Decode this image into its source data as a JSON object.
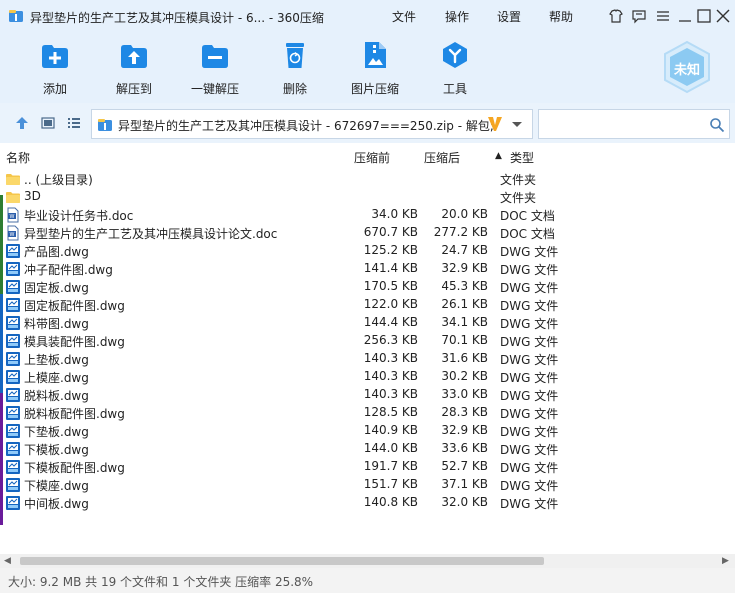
{
  "window": {
    "title": "异型垫片的生产工艺及其冲压模具设计 - 6... - 360压缩",
    "menus": [
      "文件",
      "操作",
      "设置",
      "帮助"
    ]
  },
  "toolbar": {
    "add": "添加",
    "extract_to": "解压到",
    "one_click_extract": "一键解压",
    "delete": "删除",
    "image_compress": "图片压缩",
    "tools": "工具"
  },
  "badge": {
    "label": "未知"
  },
  "address": {
    "path": "异型垫片的生产工艺及其冲压模具设计 - 672697===250.zip - 解包;"
  },
  "search": {
    "placeholder": "",
    "value": ""
  },
  "columns": {
    "name": "名称",
    "size": "压缩前",
    "packed": "压缩后",
    "type": "类型",
    "sort_glyph": "▲"
  },
  "files": [
    {
      "name": ".. (上级目录)",
      "size": "",
      "packed": "",
      "type": "文件夹",
      "icon": "folder"
    },
    {
      "name": "3D",
      "size": "",
      "packed": "",
      "type": "文件夹",
      "icon": "folder"
    },
    {
      "name": "毕业设计任务书.doc",
      "size": "34.0 KB",
      "packed": "20.0 KB",
      "type": "DOC 文档",
      "icon": "doc"
    },
    {
      "name": "异型垫片的生产工艺及其冲压模具设计论文.doc",
      "size": "670.7 KB",
      "packed": "277.2 KB",
      "type": "DOC 文档",
      "icon": "doc"
    },
    {
      "name": "产品图.dwg",
      "size": "125.2 KB",
      "packed": "24.7 KB",
      "type": "DWG 文件",
      "icon": "dwg"
    },
    {
      "name": "冲子配件图.dwg",
      "size": "141.4 KB",
      "packed": "32.9 KB",
      "type": "DWG 文件",
      "icon": "dwg"
    },
    {
      "name": "固定板.dwg",
      "size": "170.5 KB",
      "packed": "45.3 KB",
      "type": "DWG 文件",
      "icon": "dwg"
    },
    {
      "name": "固定板配件图.dwg",
      "size": "122.0 KB",
      "packed": "26.1 KB",
      "type": "DWG 文件",
      "icon": "dwg"
    },
    {
      "name": "料带图.dwg",
      "size": "144.4 KB",
      "packed": "34.1 KB",
      "type": "DWG 文件",
      "icon": "dwg"
    },
    {
      "name": "模具装配件图.dwg",
      "size": "256.3 KB",
      "packed": "70.1 KB",
      "type": "DWG 文件",
      "icon": "dwg"
    },
    {
      "name": "上垫板.dwg",
      "size": "140.3 KB",
      "packed": "31.6 KB",
      "type": "DWG 文件",
      "icon": "dwg"
    },
    {
      "name": "上模座.dwg",
      "size": "140.3 KB",
      "packed": "30.2 KB",
      "type": "DWG 文件",
      "icon": "dwg"
    },
    {
      "name": "脱料板.dwg",
      "size": "140.3 KB",
      "packed": "33.0 KB",
      "type": "DWG 文件",
      "icon": "dwg"
    },
    {
      "name": "脱料板配件图.dwg",
      "size": "128.5 KB",
      "packed": "28.3 KB",
      "type": "DWG 文件",
      "icon": "dwg"
    },
    {
      "name": "下垫板.dwg",
      "size": "140.9 KB",
      "packed": "32.9 KB",
      "type": "DWG 文件",
      "icon": "dwg"
    },
    {
      "name": "下模板.dwg",
      "size": "144.0 KB",
      "packed": "33.6 KB",
      "type": "DWG 文件",
      "icon": "dwg"
    },
    {
      "name": "下模板配件图.dwg",
      "size": "191.7 KB",
      "packed": "52.7 KB",
      "type": "DWG 文件",
      "icon": "dwg"
    },
    {
      "name": "下模座.dwg",
      "size": "151.7 KB",
      "packed": "37.1 KB",
      "type": "DWG 文件",
      "icon": "dwg"
    },
    {
      "name": "中间板.dwg",
      "size": "140.8 KB",
      "packed": "32.0 KB",
      "type": "DWG 文件",
      "icon": "dwg"
    }
  ],
  "status": {
    "text": "大小: 9.2 MB 共 19 个文件和 1 个文件夹 压缩率 25.8%"
  },
  "colors": {
    "accent": "#1e88e5",
    "toolbar_bg": "#e6f1fc",
    "folder": "#f5c64a",
    "dwg": "#1565c0",
    "brand_v": "#f5a623"
  }
}
